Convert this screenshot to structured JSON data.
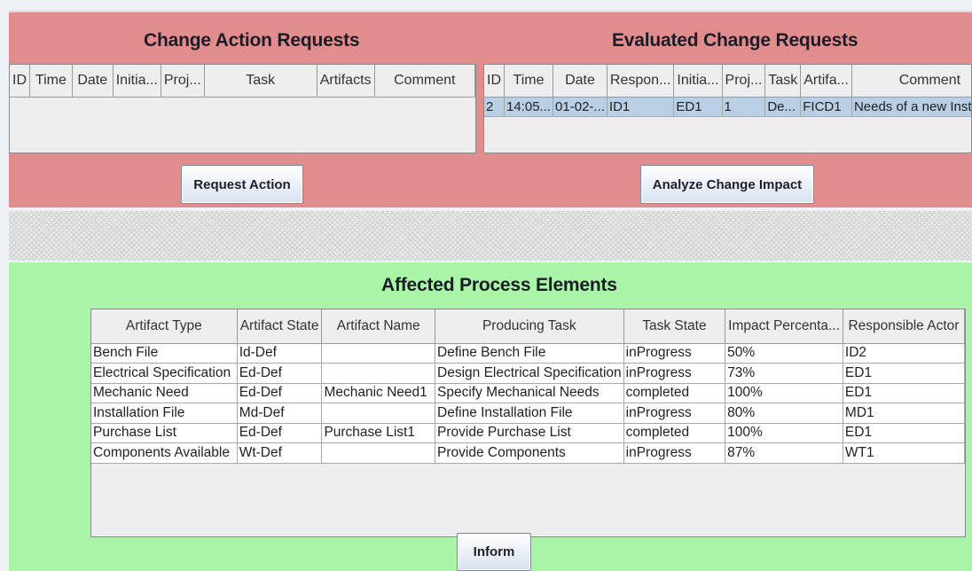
{
  "change_action": {
    "title": "Change Action Requests",
    "columns": [
      "ID",
      "Time",
      "Date",
      "Initia...",
      "Proj...",
      "Task",
      "Artifacts",
      "Comment"
    ],
    "button_label": "Request Action"
  },
  "evaluated": {
    "title": "Evaluated Change Requests",
    "columns": [
      "ID",
      "Time",
      "Date",
      "Respon...",
      "Initia...",
      "Proj...",
      "Task",
      "Artifa...",
      "Comment"
    ],
    "rows": [
      [
        "2",
        "14:05...",
        "01-02-...",
        "ID1",
        "ED1",
        "1",
        "De...",
        "FICD1",
        "Needs of a new Instrum..."
      ]
    ],
    "button_label": "Analyze Change Impact"
  },
  "affected": {
    "title": "Affected Process Elements",
    "columns": [
      "Artifact Type",
      "Artifact State",
      "Artifact Name",
      "Producing Task",
      "Task State",
      "Impact Percenta...",
      "Responsible Actor"
    ],
    "rows": [
      [
        "Bench File",
        "Id-Def",
        "",
        "Define Bench File",
        "inProgress",
        "50%",
        "ID2"
      ],
      [
        "Electrical Specification",
        "Ed-Def",
        "",
        "Design Electrical Specification",
        "inProgress",
        "73%",
        "ED1"
      ],
      [
        "Mechanic Need",
        "Ed-Def",
        "Mechanic Need1",
        "Specify Mechanical Needs",
        "completed",
        "100%",
        "ED1"
      ],
      [
        " Installation File",
        "Md-Def",
        "",
        "Define Installation File",
        "inProgress",
        "80%",
        "MD1"
      ],
      [
        "Purchase List",
        "Ed-Def",
        "Purchase List1",
        "Provide Purchase List",
        "completed",
        "100%",
        "ED1"
      ],
      [
        "Components Available",
        "Wt-Def",
        "",
        "Provide Components",
        "inProgress",
        "87%",
        "WT1"
      ]
    ],
    "button_label": "Inform"
  },
  "colors": {
    "top_panel": "#e28d8d",
    "bottom_panel": "#aaf5a7",
    "selected_row": "#b8cfe5"
  }
}
